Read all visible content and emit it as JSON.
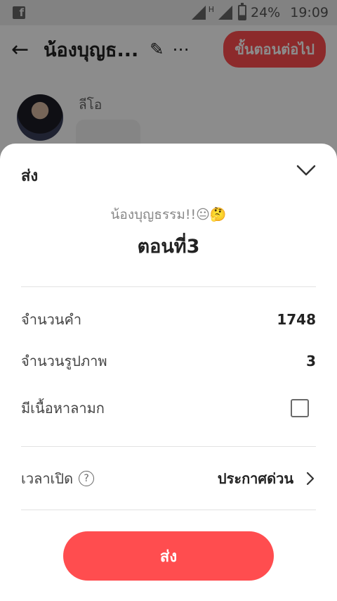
{
  "status_bar": {
    "app_badge": "f",
    "network": "H",
    "battery": "24%",
    "time": "19:09"
  },
  "header": {
    "title": "น้องบุญธ...",
    "next_button": "ขั้นตอนต่อไป"
  },
  "chat": {
    "sender_name": "ลีโอ"
  },
  "sheet": {
    "title": "ส่ง",
    "novel_title": "น้องบุญธรรม!!😐🤔",
    "chapter_title": "ตอนที่3",
    "rows": [
      {
        "label": "จำนวนคำ",
        "value": "1748"
      },
      {
        "label": "จำนวนรูปภาพ",
        "value": "3"
      },
      {
        "label": "มีเนื้อหาลามก"
      }
    ],
    "open_time": {
      "label": "เวลาเปิด",
      "help": "?",
      "value": "ประกาศด่วน"
    },
    "send_button": "ส่ง"
  },
  "colors": {
    "accent": "#ff4d4f"
  }
}
